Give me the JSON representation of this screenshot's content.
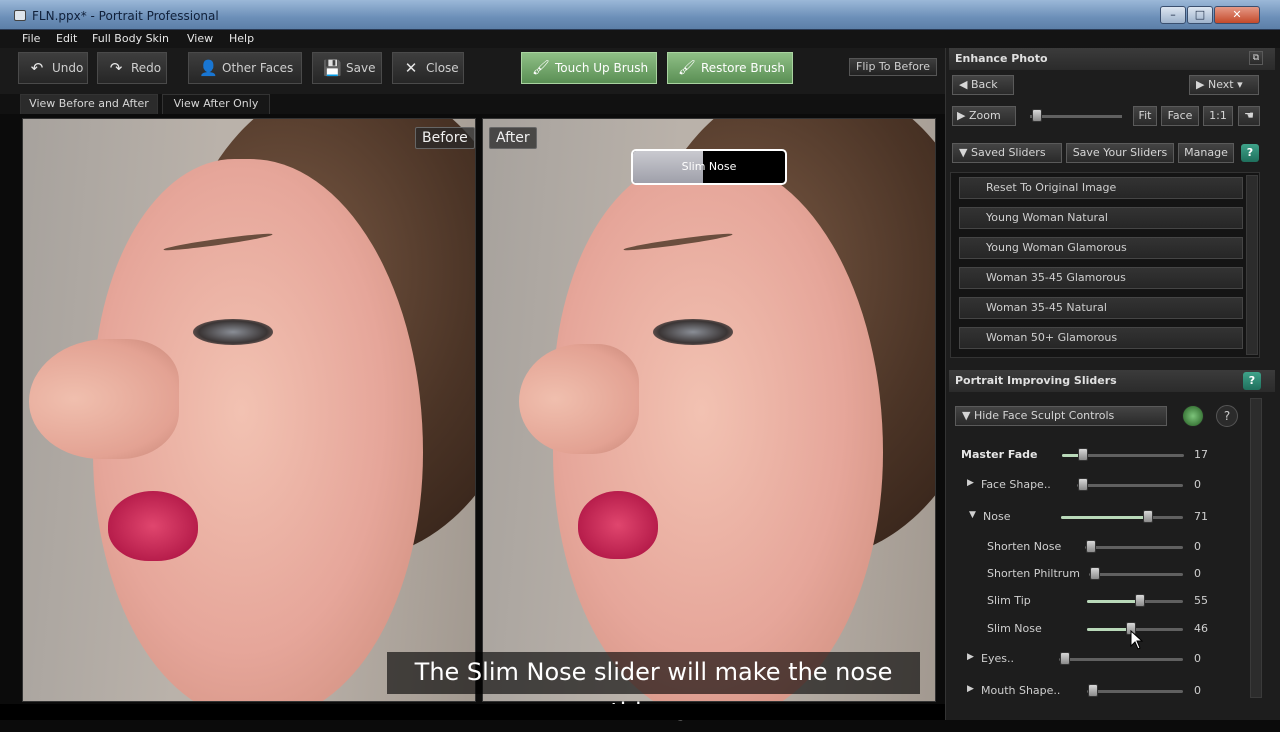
{
  "window": {
    "title": "FLN.ppx* - Portrait Professional",
    "min_label": "–",
    "max_label": "□",
    "close_label": "✕"
  },
  "menu": [
    "File",
    "Edit",
    "Full Body Skin",
    "View",
    "Help"
  ],
  "toolbar": {
    "undo": "Undo",
    "redo": "Redo",
    "other_faces": "Other Faces",
    "save": "Save",
    "close": "Close",
    "touch_up": "Touch Up Brush",
    "restore": "Restore Brush",
    "flip": "Flip To Before"
  },
  "view_tabs": {
    "before_after": "View Before and After",
    "after_only": "View After Only"
  },
  "photos": {
    "before_label": "Before",
    "after_label": "After",
    "popup": "Slim Nose"
  },
  "caption": "The Slim Nose slider will make the nose thinner",
  "enhance": {
    "title": "Enhance Photo",
    "back": "Back",
    "next": "Next",
    "zoom": "Zoom",
    "fit": "Fit",
    "face": "Face",
    "one_to_one": "1:1"
  },
  "saved": {
    "header": "Saved Sliders",
    "save_yours": "Save Your Sliders",
    "manage": "Manage",
    "items": [
      "Reset To Original Image",
      "Young Woman Natural",
      "Young Woman Glamorous",
      "Woman 35-45 Glamorous",
      "Woman 35-45 Natural",
      "Woman 50+ Glamorous"
    ]
  },
  "portrait": {
    "title": "Portrait Improving Sliders",
    "hide_controls": "Hide Face Sculpt Controls",
    "help": "?",
    "sliders": [
      {
        "name": "Master Fade",
        "value": 17,
        "level": 0.17
      },
      {
        "name": "Face Shape..",
        "value": 0,
        "level": 0
      },
      {
        "name": "Nose",
        "value": 71,
        "level": 0.71
      },
      {
        "name": "Shorten Nose",
        "value": 0,
        "level": 0
      },
      {
        "name": "Shorten Philtrum",
        "value": 0,
        "level": 0
      },
      {
        "name": "Slim Tip",
        "value": 55,
        "level": 0.55
      },
      {
        "name": "Slim Nose",
        "value": 46,
        "level": 0.46
      },
      {
        "name": "Eyes..",
        "value": 0,
        "level": 0
      },
      {
        "name": "Mouth Shape..",
        "value": 0,
        "level": 0
      }
    ]
  },
  "colors": {
    "accent_green": "#6fa867",
    "help_teal": "#2a8a73",
    "panel_bg": "#1d1d1d"
  }
}
